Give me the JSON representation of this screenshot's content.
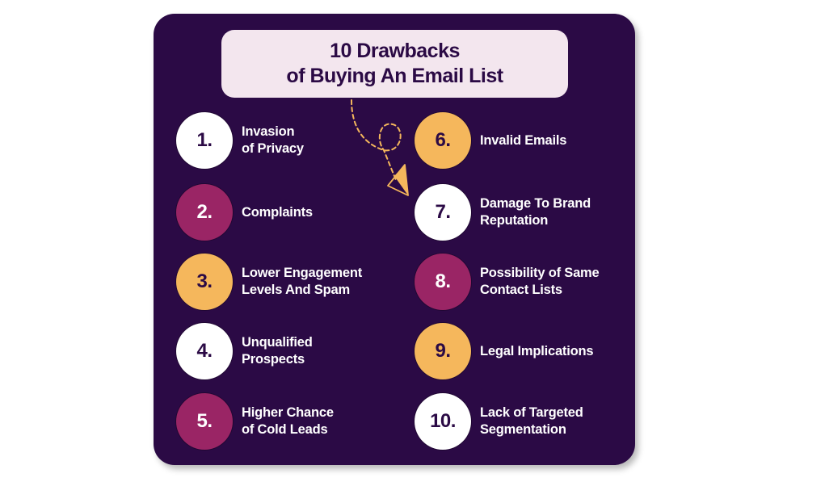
{
  "title": {
    "line1": "10 Drawbacks",
    "line2": "of Buying An Email List"
  },
  "colors": {
    "background": "#2b0a45",
    "title_box": "#f3e6ee",
    "white": "#ffffff",
    "magenta": "#9a2565",
    "yellow": "#f5b75c"
  },
  "items": [
    {
      "number": "1.",
      "label": "Invasion\nof Privacy",
      "color": "white"
    },
    {
      "number": "2.",
      "label": "Complaints",
      "color": "magenta"
    },
    {
      "number": "3.",
      "label": "Lower Engagement\nLevels And Spam",
      "color": "yellow"
    },
    {
      "number": "4.",
      "label": "Unqualified\nProspects",
      "color": "white"
    },
    {
      "number": "5.",
      "label": "Higher Chance\nof Cold Leads",
      "color": "magenta"
    },
    {
      "number": "6.",
      "label": "Invalid Emails",
      "color": "yellow"
    },
    {
      "number": "7.",
      "label": "Damage To Brand\nReputation",
      "color": "white"
    },
    {
      "number": "8.",
      "label": "Possibility of Same\nContact Lists",
      "color": "magenta"
    },
    {
      "number": "9.",
      "label": "Legal Implications",
      "color": "yellow"
    },
    {
      "number": "10.",
      "label": "Lack of Targeted\nSegmentation",
      "color": "white"
    }
  ],
  "decorations": {
    "arrow": "dashed-paper-plane-path-icon"
  }
}
